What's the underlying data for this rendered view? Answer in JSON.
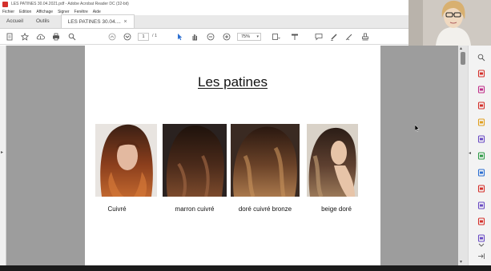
{
  "window": {
    "title": "LES PATINES 30.04.2021.pdf - Adobe Acrobat Reader DC (32-bit)"
  },
  "menu": [
    "Fichier",
    "Edition",
    "Affichage",
    "Signer",
    "Fenêtre",
    "Aide"
  ],
  "tabs": [
    {
      "label": "Accueil"
    },
    {
      "label": "Outils"
    },
    {
      "label": "LES PATINES 30.04....",
      "close": "×"
    }
  ],
  "toolbar": {
    "page_current": "1",
    "page_total": "/ 1",
    "zoom": "75%"
  },
  "document": {
    "title": "Les patines",
    "photos": [
      {
        "caption": "Cuivré",
        "colors": {
          "top": "#3a1f14",
          "mid": "#8a3e1c",
          "bottom": "#c0662e"
        }
      },
      {
        "caption": "marron cuivré",
        "colors": {
          "top": "#1e120c",
          "mid": "#4a2a1a",
          "bottom": "#7b4a2c"
        }
      },
      {
        "caption": "doré cuivré bronze",
        "colors": {
          "top": "#2a1810",
          "mid": "#6a4228",
          "bottom": "#a9784c"
        }
      },
      {
        "caption": "beige doré",
        "colors": {
          "top": "#2b1d16",
          "mid": "#5e4030",
          "bottom": "#9a7858"
        }
      }
    ]
  },
  "colors": {
    "acrobat_red": "#d4302b",
    "viewer_gray": "#9d9d9d",
    "tool_icons": [
      "#6a4bc4",
      "#d4302b",
      "#c0308a",
      "#d4302b",
      "#e0a020",
      "#6a4bc4",
      "#2e9b46",
      "#2c6fd1",
      "#d4302b",
      "#6a4bc4",
      "#d4302b",
      "#6a4bc4",
      "#e0a020"
    ]
  }
}
